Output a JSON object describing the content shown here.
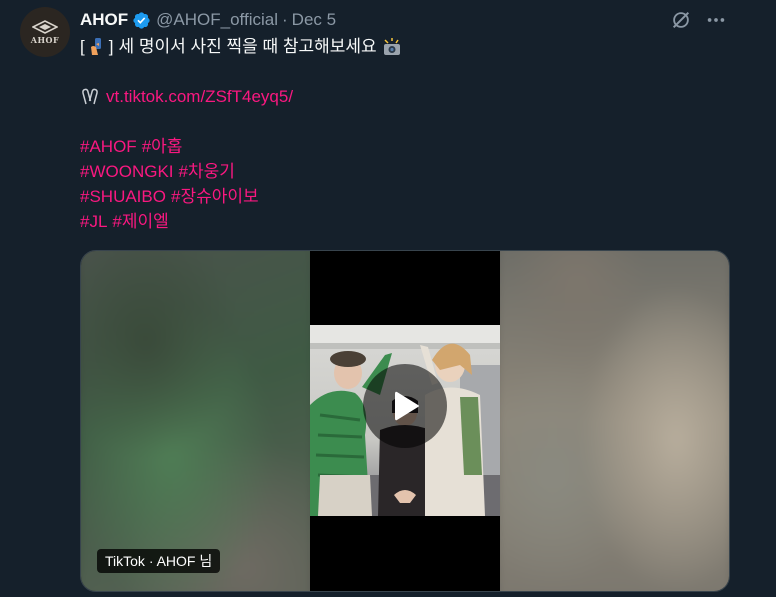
{
  "author": {
    "display_name": "AHOF",
    "handle": "@AHOF_official",
    "separator": "·",
    "date": "Dec 5",
    "avatar_text": "AHOF",
    "verified": true
  },
  "tweet": {
    "line1": "세 명이서 사진 찍을 때 참고해보세요",
    "bracket_open": "[",
    "bracket_close": "]",
    "link": "vt.tiktok.com/ZSfT4eyq5/",
    "hashtag_lines": [
      [
        "#AHOF",
        "#아홉"
      ],
      [
        "#WOONGKI",
        "#차웅기"
      ],
      [
        "#SHUAIBO",
        "#장슈아이보"
      ],
      [
        "#JL",
        "#제이엘"
      ]
    ]
  },
  "media": {
    "attribution": "TikTok · AHOF 님"
  },
  "icons": {
    "verified": "verified-badge-icon",
    "grok": "grok-icon",
    "more": "more-options-icon",
    "link": "link-paperclip-icon",
    "emoji1": "selfie-hand-emoji-icon",
    "emoji2": "camera-flash-emoji-icon",
    "play": "play-icon"
  },
  "colors": {
    "background": "#15202b",
    "text": "#f7f9f9",
    "secondary": "#8b98a5",
    "link": "#f91880",
    "verified": "#1d9bf0"
  }
}
